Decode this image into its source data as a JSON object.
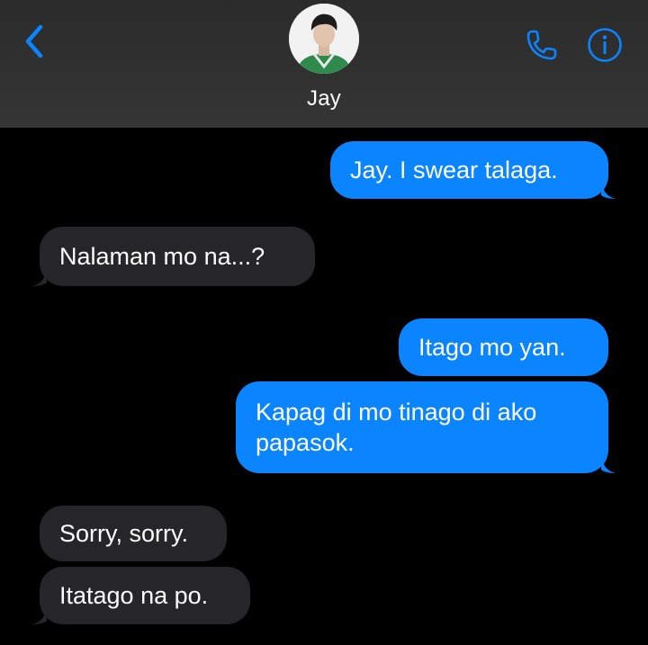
{
  "header": {
    "contact_name": "Jay",
    "back_icon": "chevron-left-icon",
    "call_icon": "phone-icon",
    "info_icon": "info-icon",
    "accent_color": "#0a84ff"
  },
  "messages": [
    {
      "direction": "sent",
      "text": "Jay. I swear talaga."
    },
    {
      "direction": "received",
      "text": "Nalaman mo na...?"
    },
    {
      "direction": "sent",
      "text": "Itago mo yan."
    },
    {
      "direction": "sent",
      "text": "Kapag di mo tinago di ako papasok."
    },
    {
      "direction": "received",
      "text": "Sorry, sorry."
    },
    {
      "direction": "received",
      "text": "Itatago na po."
    }
  ],
  "colors": {
    "sent_bubble": "#0a84ff",
    "received_bubble": "#262629",
    "background": "#000000",
    "header_background": "#303030"
  }
}
